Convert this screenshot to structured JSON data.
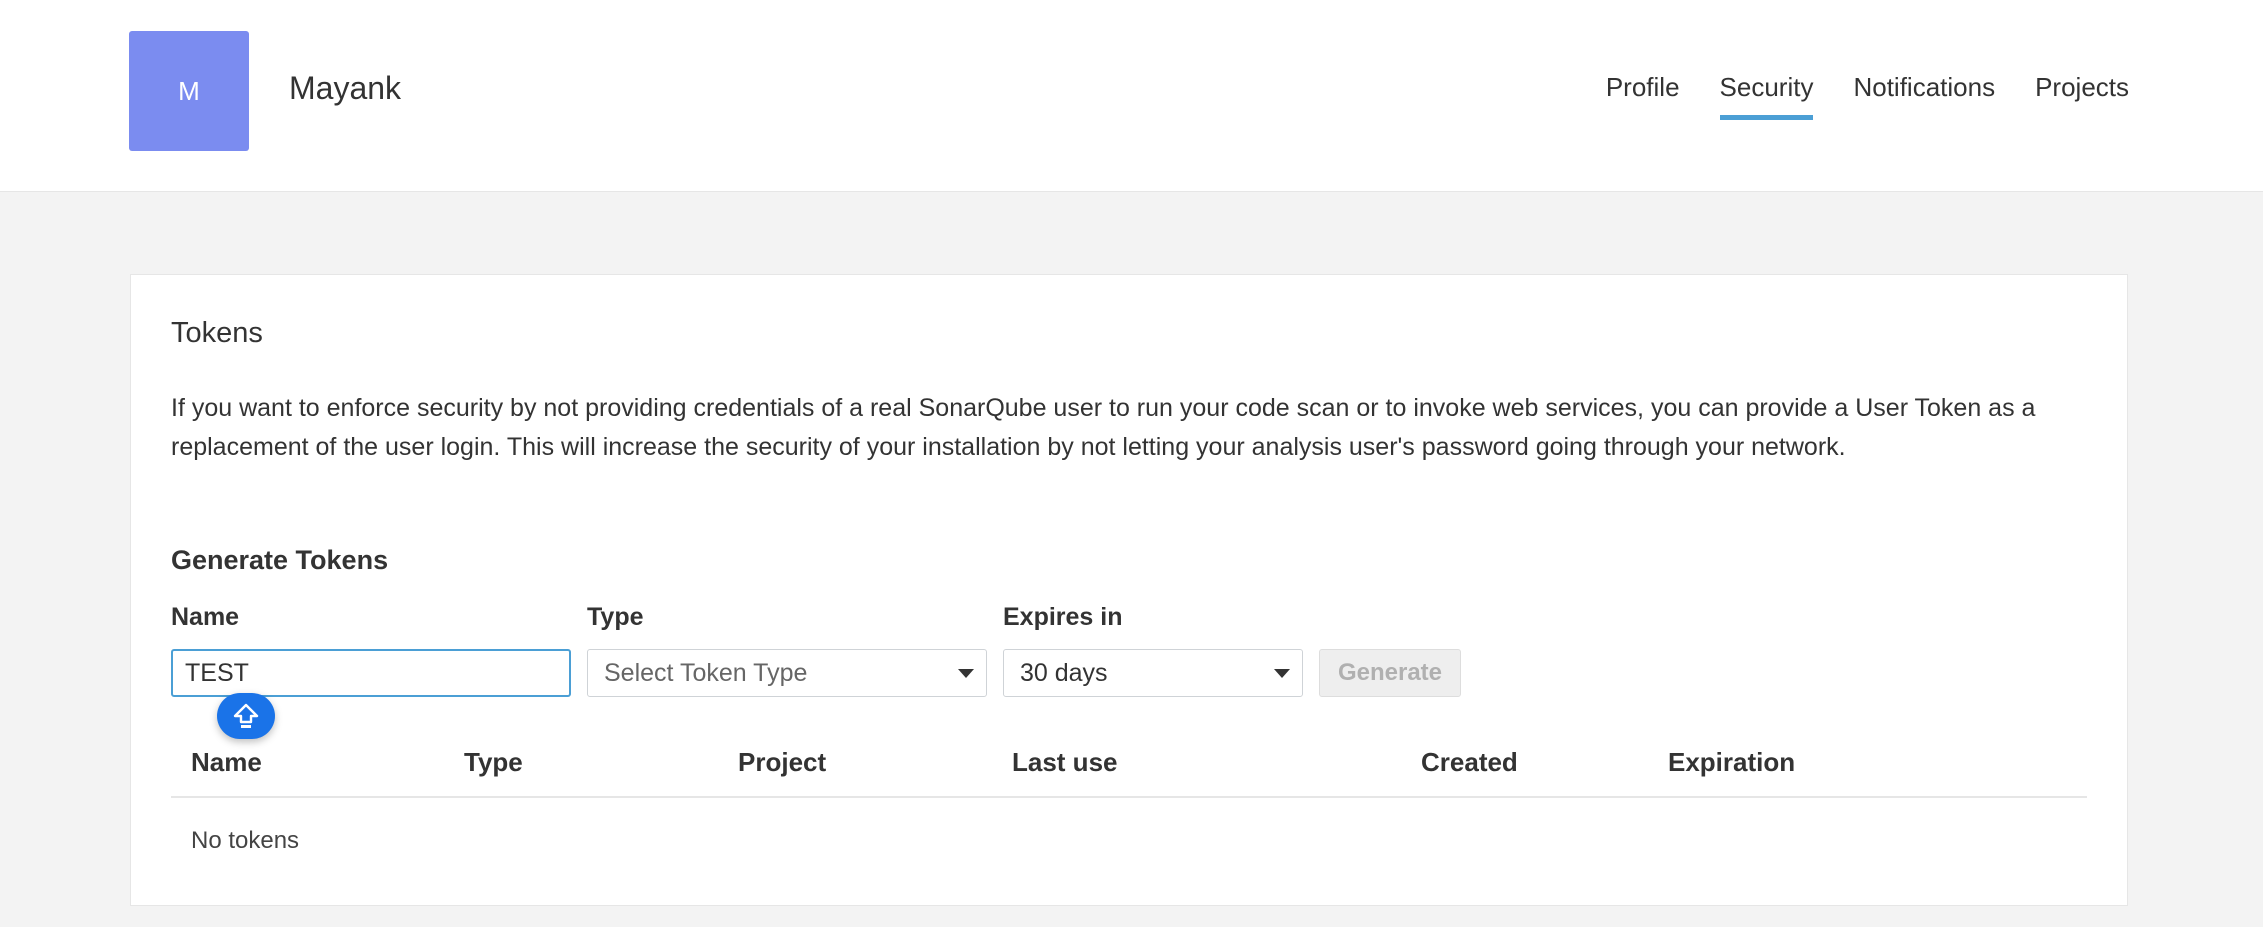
{
  "user": {
    "avatar_initial": "M",
    "name": "Mayank",
    "avatar_color": "#7b8cf0"
  },
  "nav": {
    "tabs": [
      {
        "label": "Profile",
        "active": false
      },
      {
        "label": "Security",
        "active": true
      },
      {
        "label": "Notifications",
        "active": false
      },
      {
        "label": "Projects",
        "active": false
      }
    ],
    "accent_color": "#4b9fd5"
  },
  "tokens": {
    "title": "Tokens",
    "description": "If you want to enforce security by not providing credentials of a real SonarQube user to run your code scan or to invoke web services, you can provide a User Token as a replacement of the user login. This will increase the security of your installation by not letting your analysis user's password going through your network.",
    "generate": {
      "title": "Generate Tokens",
      "name_label": "Name",
      "name_value": "TEST",
      "type_label": "Type",
      "type_placeholder": "Select Token Type",
      "expires_label": "Expires in",
      "expires_value": "30 days",
      "button_label": "Generate"
    },
    "table": {
      "columns": [
        "Name",
        "Type",
        "Project",
        "Last use",
        "Created",
        "Expiration"
      ],
      "empty_text": "No tokens"
    }
  },
  "icons": {
    "caps_lock": "caps-lock-icon"
  }
}
